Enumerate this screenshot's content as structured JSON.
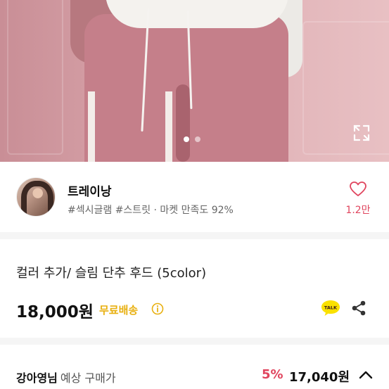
{
  "photo": {
    "slide_count": 2,
    "active_slide": 1,
    "expand_icon": "expand-icon"
  },
  "shop": {
    "name": "트레이낭",
    "tags": "#섹시글램 #스트릿 · 마켓 만족도 92%",
    "like_icon": "heart-icon",
    "like_count": "1.2만"
  },
  "product": {
    "title": "컬러 추가/ 슬림 단추 후드 (5color)",
    "price": "18,000원",
    "shipping": "무료배송",
    "info_icon": "info-icon",
    "talk_icon": "talk-icon",
    "talk_label": "TALK",
    "share_icon": "share-icon"
  },
  "buyer": {
    "name": "강아영님",
    "label": "예상 구매가",
    "discount": "5%",
    "final_price": "17,040원",
    "toggle_icon": "chevron-up-icon"
  },
  "colors": {
    "accent_pink": "#e0455e",
    "shipping_yellow": "#e8b010",
    "talk_yellow": "#fae100"
  }
}
